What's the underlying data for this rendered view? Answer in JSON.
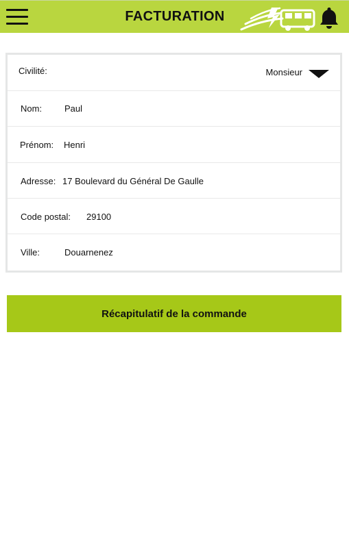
{
  "header": {
    "title": "FACTURATION",
    "menu_icon": "hamburger-menu-icon",
    "logo_icon": "bus-logo-icon",
    "bell_icon": "bell-icon",
    "bar_color": "#b9d63f"
  },
  "form": {
    "civilite": {
      "label": "Civilité:",
      "value": "Monsieur"
    },
    "nom": {
      "label": "Nom:",
      "value": "Paul"
    },
    "prenom": {
      "label": "Prénom:",
      "value": "Henri"
    },
    "adresse": {
      "label": "Adresse:",
      "value": "17 Boulevard du Général De Gaulle"
    },
    "code_postal": {
      "label": "Code postal:",
      "value": "29100"
    },
    "ville": {
      "label": "Ville:",
      "value": "Douarnenez"
    }
  },
  "actions": {
    "summary_label": "Récapitulatif de la commande",
    "summary_color": "#a6c818"
  }
}
